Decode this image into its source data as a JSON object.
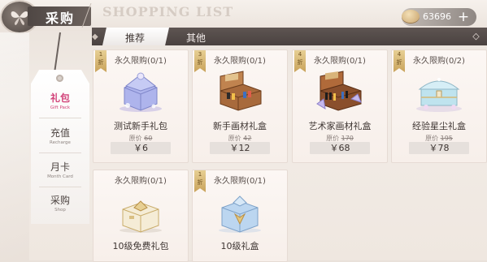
{
  "header": {
    "title": "采购",
    "watermark": "SHOPPING LIST"
  },
  "currency": {
    "amount": "63696",
    "add_label": "+"
  },
  "tabs": [
    {
      "label": "推荐",
      "active": true
    },
    {
      "label": "其他",
      "active": false
    }
  ],
  "sidebar": {
    "items": [
      {
        "label": "礼包",
        "sub": "Gift Pack",
        "active": true
      },
      {
        "label": "充值",
        "sub": "Recharge",
        "active": false
      },
      {
        "label": "月卡",
        "sub": "Month Card",
        "active": false
      },
      {
        "label": "采购",
        "sub": "Shop",
        "active": false
      }
    ]
  },
  "common": {
    "orig_prefix": "原价"
  },
  "products": [
    {
      "limit": "永久限购(0/1)",
      "discount_num": "1",
      "discount_unit": "折",
      "name": "测试新手礼包",
      "orig_price": "60",
      "price": "￥6",
      "art": "box-lavender-icon"
    },
    {
      "limit": "永久限购(0/1)",
      "discount_num": "3",
      "discount_unit": "折",
      "name": "新手画材礼盒",
      "orig_price": "42",
      "price": "￥12",
      "art": "wooden-paint-box-icon"
    },
    {
      "limit": "永久限购(0/1)",
      "discount_num": "4",
      "discount_unit": "折",
      "name": "艺术家画材礼盒",
      "orig_price": "170",
      "price": "￥68",
      "art": "artist-paint-box-icon"
    },
    {
      "limit": "永久限购(0/2)",
      "discount_num": "4",
      "discount_unit": "折",
      "name": "经验星尘礼盒",
      "orig_price": "195",
      "price": "￥78",
      "art": "stardust-chest-icon"
    },
    {
      "limit": "永久限购(0/1)",
      "discount_num": "",
      "discount_unit": "",
      "name": "10级免费礼包",
      "orig_price": "",
      "price": "",
      "art": "cream-gift-box-icon"
    },
    {
      "limit": "永久限购(0/1)",
      "discount_num": "1",
      "discount_unit": "折",
      "name": "10级礼盒",
      "orig_price": "",
      "price": "",
      "art": "blue-gift-box-icon"
    }
  ]
}
